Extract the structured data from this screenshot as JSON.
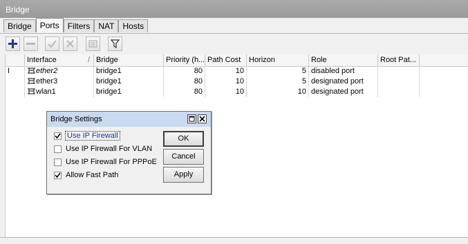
{
  "window": {
    "title": "Bridge"
  },
  "tabs": [
    {
      "label": "Bridge"
    },
    {
      "label": "Ports"
    },
    {
      "label": "Filters"
    },
    {
      "label": "NAT"
    },
    {
      "label": "Hosts"
    }
  ],
  "toolbar": {
    "buttons": [
      "add-icon",
      "remove-icon",
      "enable-icon",
      "disable-icon",
      "comment-icon",
      "filter-icon"
    ]
  },
  "table": {
    "columns": [
      "Interface",
      "Bridge",
      "Priority (h...",
      "Path Cost",
      "Horizon",
      "Role",
      "Root Pat..."
    ],
    "rows": [
      {
        "flag": "I",
        "interface": "ether2",
        "bridge": "bridge1",
        "priority": "80",
        "path_cost": "10",
        "horizon": "5",
        "role": "disabled port",
        "root_path": ""
      },
      {
        "flag": "",
        "interface": "ether3",
        "bridge": "bridge1",
        "priority": "80",
        "path_cost": "10",
        "horizon": "5",
        "role": "designated port",
        "root_path": ""
      },
      {
        "flag": "",
        "interface": "wlan1",
        "bridge": "bridge1",
        "priority": "80",
        "path_cost": "10",
        "horizon": "10",
        "role": "designated port",
        "root_path": ""
      }
    ]
  },
  "dialog": {
    "title": "Bridge Settings",
    "options": [
      {
        "label": "Use IP Firewall",
        "checked": true
      },
      {
        "label": "Use IP Firewall For VLAN",
        "checked": false
      },
      {
        "label": "Use IP Firewall For PPPoE",
        "checked": false
      },
      {
        "label": "Allow Fast Path",
        "checked": true
      }
    ],
    "ok_label": "OK",
    "cancel_label": "Cancel",
    "apply_label": "Apply"
  },
  "colors": {
    "add_icon": "#1a3c8f",
    "title_bar": "#a0a0a0",
    "dialog_title": "#c9d9f0"
  }
}
